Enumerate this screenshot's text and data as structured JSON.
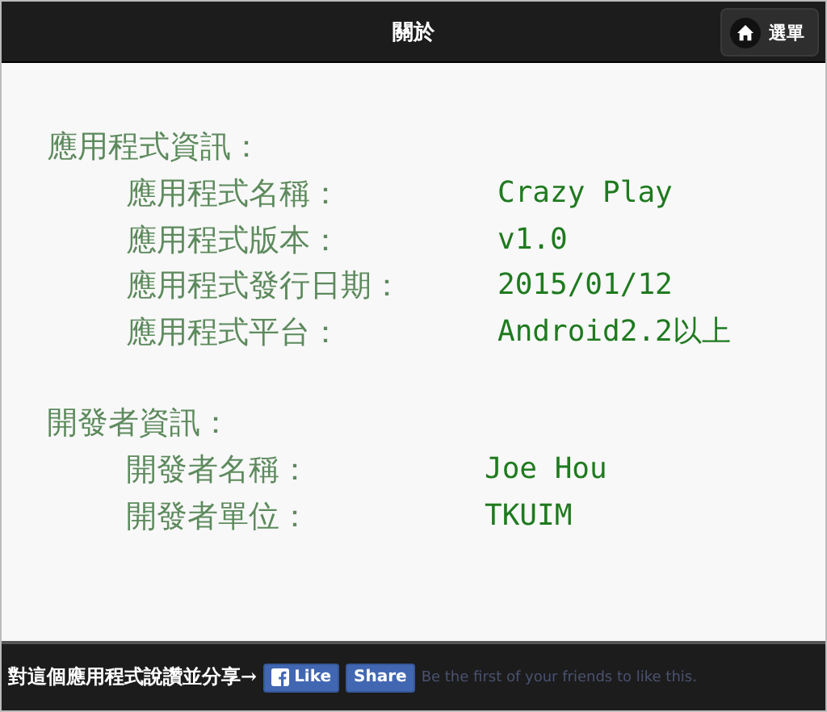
{
  "header": {
    "title": "關於",
    "menu_button": {
      "label": "選單"
    }
  },
  "sections": [
    {
      "title": "應用程式資訊：",
      "rows": [
        {
          "label": "應用程式名稱：",
          "value": "Crazy Play"
        },
        {
          "label": "應用程式版本：",
          "value": "v1.0"
        },
        {
          "label": "應用程式發行日期：",
          "value": "2015/01/12"
        },
        {
          "label": "應用程式平台：",
          "value": "Android2.2以上"
        }
      ]
    },
    {
      "title": "開發者資訊：",
      "rows": [
        {
          "label": "開發者名稱：",
          "value": "Joe Hou"
        },
        {
          "label": "開發者單位：",
          "value": "TKUIM"
        }
      ]
    }
  ],
  "footer": {
    "text": "對這個應用程式說讚並分享→",
    "like_button": "Like",
    "share_button": "Share",
    "social_text": "Be the first of your friends to like this."
  }
}
